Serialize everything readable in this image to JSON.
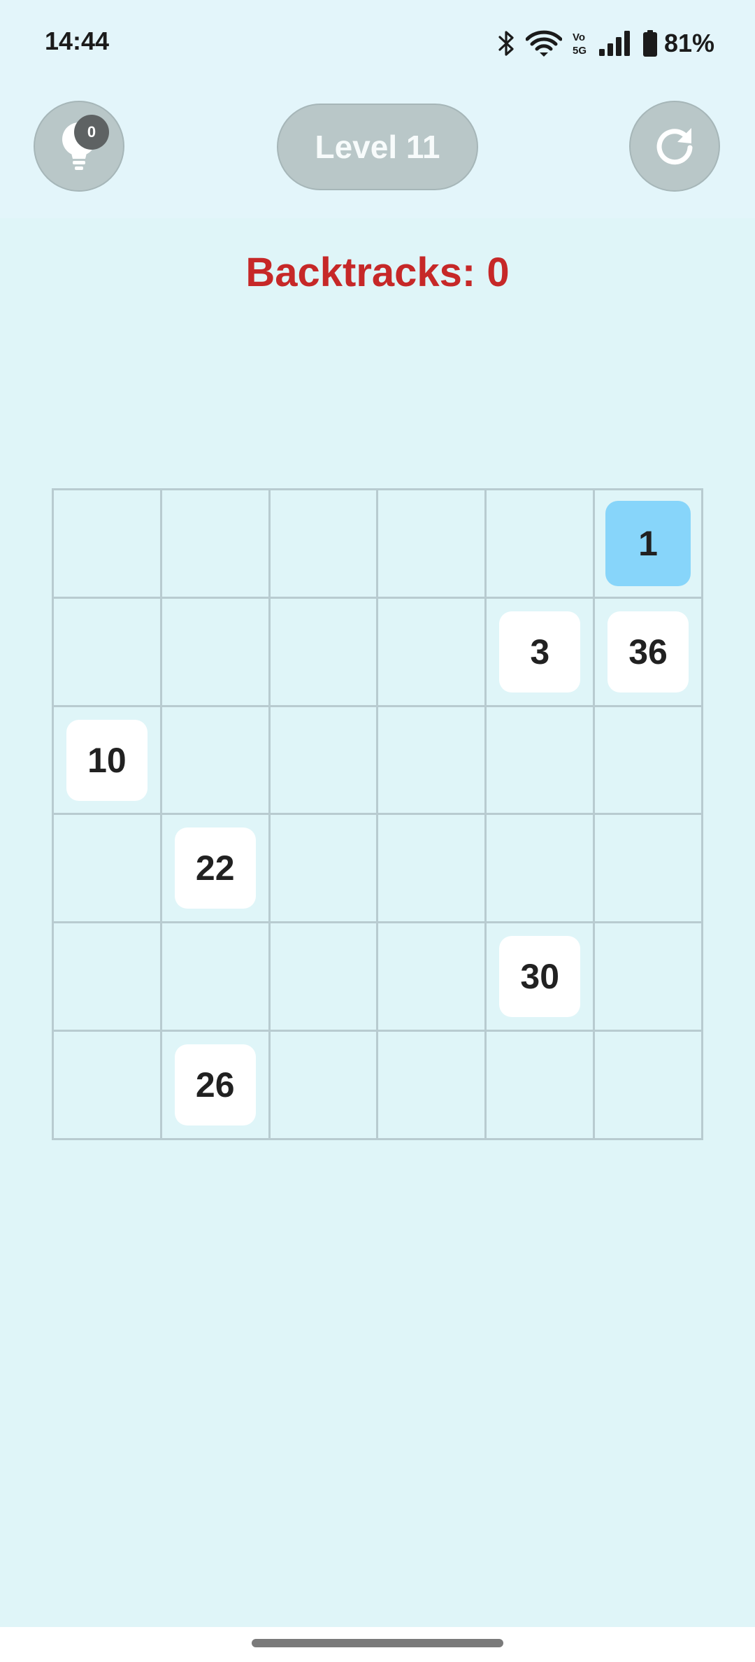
{
  "status_bar": {
    "time": "14:44",
    "battery_percent": "81%",
    "icons": [
      "bluetooth-icon",
      "wifi-icon",
      "volte-icon",
      "signal-icon",
      "battery-icon"
    ]
  },
  "header": {
    "hint_count": "0",
    "level_label": "Level 11",
    "hint_icon": "lightbulb-icon",
    "restart_icon": "restart-icon"
  },
  "game": {
    "backtracks_label": "Backtracks: 0",
    "grid_size": 6,
    "cells": [
      [
        "",
        "",
        "",
        "",
        "",
        "1"
      ],
      [
        "",
        "",
        "",
        "",
        "3",
        "36"
      ],
      [
        "10",
        "",
        "",
        "",
        "",
        ""
      ],
      [
        "",
        "22",
        "",
        "",
        "",
        ""
      ],
      [
        "",
        "",
        "",
        "",
        "30",
        ""
      ],
      [
        "",
        "26",
        "",
        "",
        "",
        ""
      ]
    ],
    "active_value": "1"
  },
  "colors": {
    "background": "#dff5f8",
    "backtracks_text": "#c62828",
    "active_tile": "#87d5fa",
    "tile": "#ffffff",
    "button": "#b9c7c8"
  }
}
